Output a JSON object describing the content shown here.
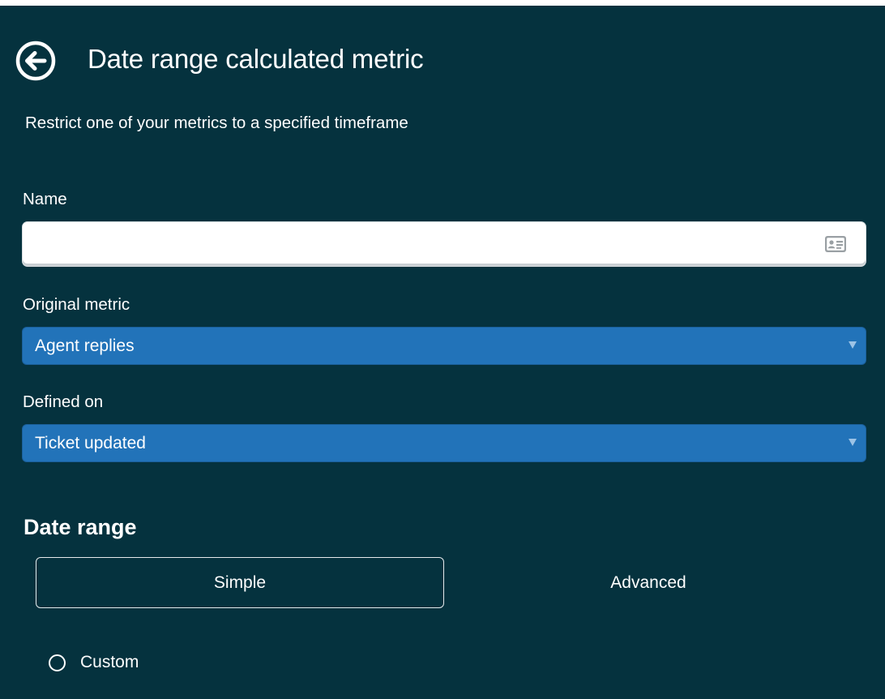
{
  "header": {
    "title": "Date range calculated metric",
    "back_icon": "circle-arrow-left-icon"
  },
  "subtitle": "Restrict one of your metrics to a specified timeframe",
  "form": {
    "name": {
      "label": "Name",
      "value": "",
      "placeholder": "",
      "icon": "contact-card-icon"
    },
    "original_metric": {
      "label": "Original metric",
      "selected": "Agent replies"
    },
    "defined_on": {
      "label": "Defined on",
      "selected": "Ticket updated"
    }
  },
  "date_range": {
    "heading": "Date range",
    "tabs": [
      {
        "label": "Simple",
        "active": true
      },
      {
        "label": "Advanced",
        "active": false
      }
    ],
    "options": [
      {
        "label": "Custom",
        "selected": false
      }
    ]
  },
  "colors": {
    "background": "#05323e",
    "select_background": "#2273b9",
    "text": "#ffffff"
  }
}
